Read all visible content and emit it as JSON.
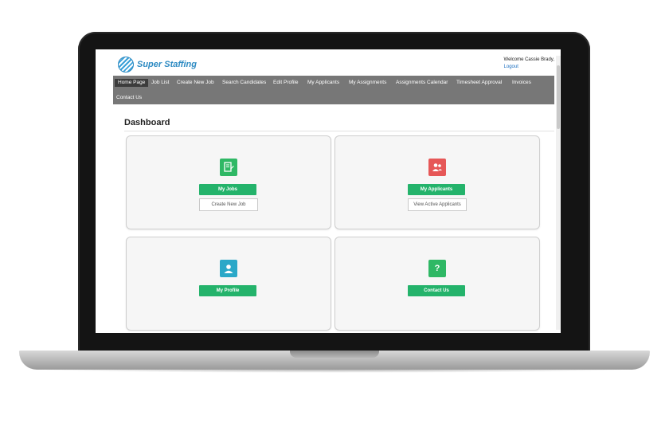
{
  "header": {
    "logo_text": "Super Staffing",
    "welcome_text": "Welcome Cassie Brady,",
    "logout_label": "Logout"
  },
  "nav": {
    "items": [
      {
        "label": "Home Page",
        "active": true
      },
      {
        "label": "Job List"
      },
      {
        "label": "Create New Job"
      },
      {
        "label": "Search Candidates"
      },
      {
        "label": "Edit Profile"
      },
      {
        "label": "My Applicants"
      },
      {
        "label": "My Assignments"
      },
      {
        "label": "Assignments Calendar"
      },
      {
        "label": "Timesheet Approval"
      },
      {
        "label": "Invoices"
      },
      {
        "label": "Contact Us"
      }
    ]
  },
  "dashboard": {
    "title": "Dashboard",
    "cards": [
      {
        "icon": "document-edit-icon",
        "icon_color": "#2fb865",
        "primary_label": "My Jobs",
        "secondary_label": "Create New Job"
      },
      {
        "icon": "users-icon",
        "icon_color": "#e65757",
        "primary_label": "My Applicants",
        "secondary_label": "View Active Applicants"
      },
      {
        "icon": "user-profile-icon",
        "icon_color": "#2aa8c8",
        "primary_label": "My Profile"
      },
      {
        "icon": "question-icon",
        "icon_color": "#2fb865",
        "icon_glyph": "?",
        "primary_label": "Contact Us"
      }
    ]
  },
  "colors": {
    "nav_background": "#777777",
    "nav_active": "#3c3c3c",
    "button_green": "#24b36b",
    "link_blue": "#1a6ec0"
  }
}
